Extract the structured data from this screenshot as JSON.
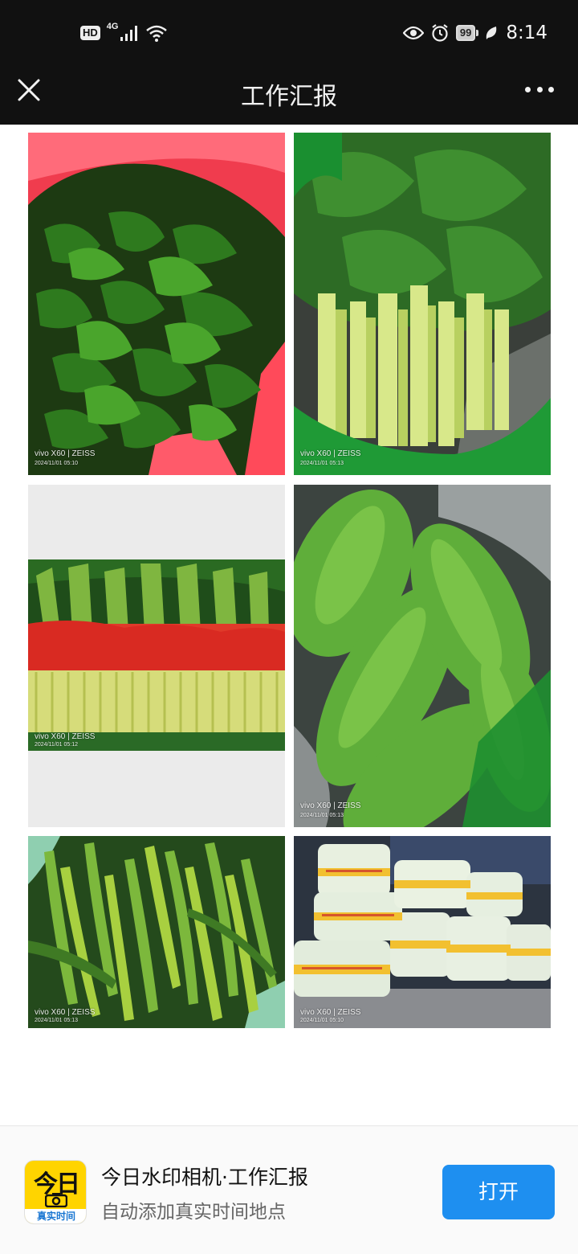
{
  "status_bar": {
    "hd": "HD",
    "network": "4G",
    "battery": "99",
    "time": "8:14",
    "icons": [
      "signal-icon",
      "wifi-icon",
      "eye-icon",
      "alarm-icon",
      "battery-icon",
      "leaf-icon"
    ]
  },
  "nav": {
    "title": "工作汇报",
    "close_icon": "close-icon",
    "more_icon": "more-icon"
  },
  "photos": [
    {
      "subject": "kelp",
      "brand": "vivo X60 | ZEISS",
      "timestamp": "2024/11/01 05:10"
    },
    {
      "subject": "bok-choy",
      "brand": "vivo X60 | ZEISS",
      "timestamp": "2024/11/01 05:13"
    },
    {
      "subject": "garlic-chives",
      "brand": "vivo X60 | ZEISS",
      "timestamp": "2024/11/01 05:12"
    },
    {
      "subject": "bitter-melon",
      "brand": "vivo X60 | ZEISS",
      "timestamp": "2024/11/01 05:13"
    },
    {
      "subject": "green-peppers",
      "brand": "vivo X60 | ZEISS",
      "timestamp": "2024/11/01 05:13"
    },
    {
      "subject": "bagged-cabbage",
      "brand": "vivo X60 | ZEISS",
      "timestamp": "2024/11/01 05:10"
    }
  ],
  "banner": {
    "app_icon_text": "今日",
    "app_icon_label": "真实时间",
    "title": "今日水印相机·工作汇报",
    "subtitle": "自动添加真实时间地点",
    "open_label": "打开"
  },
  "colors": {
    "header_bg": "#111111",
    "button_blue": "#1e8ff0",
    "app_yellow": "#ffd400"
  }
}
